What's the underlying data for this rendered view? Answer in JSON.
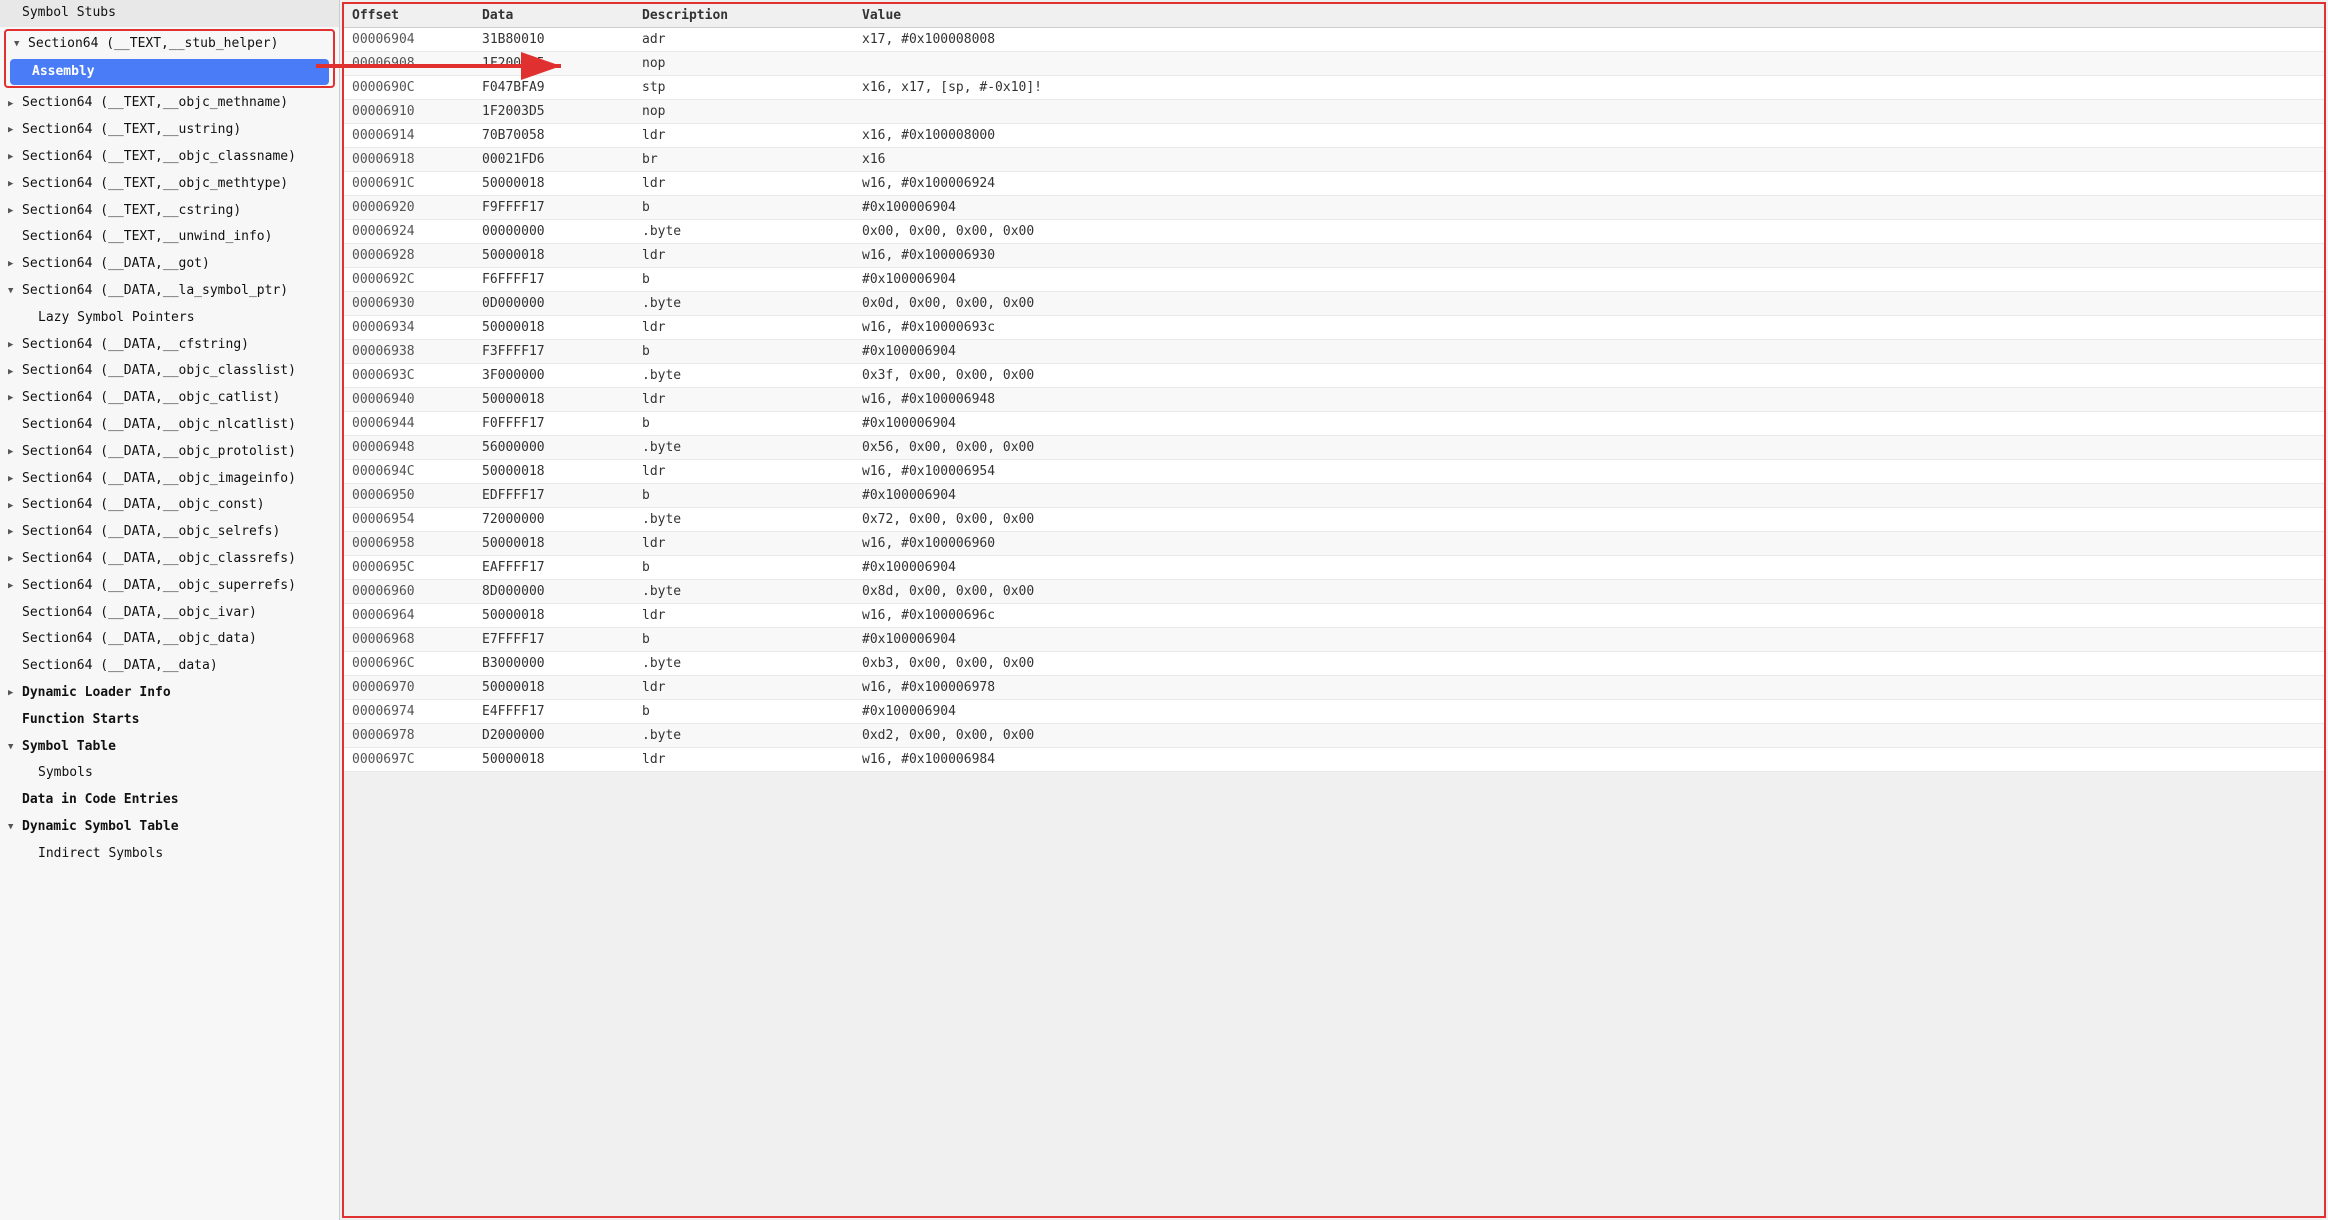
{
  "sidebar": {
    "items": [
      {
        "id": "symbol-stubs",
        "label": "Symbol Stubs",
        "indent": 0,
        "triangle": "none",
        "type": "leaf",
        "bold": false
      },
      {
        "id": "section64-stub-helper",
        "label": "Section64 (__TEXT,__stub_helper)",
        "indent": 0,
        "triangle": "open",
        "type": "parent",
        "bold": false,
        "highlighted": true
      },
      {
        "id": "assembly",
        "label": "Assembly",
        "indent": 1,
        "triangle": "none",
        "type": "selected",
        "bold": true
      },
      {
        "id": "section64-methname",
        "label": "Section64 (__TEXT,__objc_methname)",
        "indent": 0,
        "triangle": "closed",
        "type": "parent",
        "bold": false
      },
      {
        "id": "section64-ustring",
        "label": "Section64 (__TEXT,__ustring)",
        "indent": 0,
        "triangle": "closed",
        "type": "parent",
        "bold": false
      },
      {
        "id": "section64-classname",
        "label": "Section64 (__TEXT,__objc_classname)",
        "indent": 0,
        "triangle": "closed",
        "type": "parent",
        "bold": false
      },
      {
        "id": "section64-methtype",
        "label": "Section64 (__TEXT,__objc_methtype)",
        "indent": 0,
        "triangle": "closed",
        "type": "parent",
        "bold": false
      },
      {
        "id": "section64-cstring",
        "label": "Section64 (__TEXT,__cstring)",
        "indent": 0,
        "triangle": "closed",
        "type": "parent",
        "bold": false
      },
      {
        "id": "section64-unwind",
        "label": "Section64 (__TEXT,__unwind_info)",
        "indent": 0,
        "triangle": "none",
        "type": "leaf",
        "bold": false
      },
      {
        "id": "section64-got",
        "label": "Section64 (__DATA,__got)",
        "indent": 0,
        "triangle": "closed",
        "type": "parent",
        "bold": false
      },
      {
        "id": "section64-la-symbol",
        "label": "Section64 (__DATA,__la_symbol_ptr)",
        "indent": 0,
        "triangle": "open",
        "type": "parent",
        "bold": false
      },
      {
        "id": "lazy-symbol-pointers",
        "label": "Lazy Symbol Pointers",
        "indent": 1,
        "triangle": "none",
        "type": "leaf",
        "bold": false
      },
      {
        "id": "section64-cfstring",
        "label": "Section64 (__DATA,__cfstring)",
        "indent": 0,
        "triangle": "closed",
        "type": "parent",
        "bold": false
      },
      {
        "id": "section64-classlist",
        "label": "Section64 (__DATA,__objc_classlist)",
        "indent": 0,
        "triangle": "closed",
        "type": "parent",
        "bold": false
      },
      {
        "id": "section64-catlist",
        "label": "Section64 (__DATA,__objc_catlist)",
        "indent": 0,
        "triangle": "closed",
        "type": "parent",
        "bold": false
      },
      {
        "id": "section64-nlcatlist",
        "label": "Section64 (__DATA,__objc_nlcatlist)",
        "indent": 0,
        "triangle": "none",
        "type": "leaf",
        "bold": false
      },
      {
        "id": "section64-protolist",
        "label": "Section64 (__DATA,__objc_protolist)",
        "indent": 0,
        "triangle": "closed",
        "type": "parent",
        "bold": false
      },
      {
        "id": "section64-imageinfo",
        "label": "Section64 (__DATA,__objc_imageinfo)",
        "indent": 0,
        "triangle": "closed",
        "type": "parent",
        "bold": false
      },
      {
        "id": "section64-const",
        "label": "Section64 (__DATA,__objc_const)",
        "indent": 0,
        "triangle": "closed",
        "type": "parent",
        "bold": false
      },
      {
        "id": "section64-selrefs",
        "label": "Section64 (__DATA,__objc_selrefs)",
        "indent": 0,
        "triangle": "closed",
        "type": "parent",
        "bold": false
      },
      {
        "id": "section64-classrefs",
        "label": "Section64 (__DATA,__objc_classrefs)",
        "indent": 0,
        "triangle": "closed",
        "type": "parent",
        "bold": false
      },
      {
        "id": "section64-superrefs",
        "label": "Section64 (__DATA,__objc_superrefs)",
        "indent": 0,
        "triangle": "closed",
        "type": "parent",
        "bold": false
      },
      {
        "id": "section64-ivar",
        "label": "Section64 (__DATA,__objc_ivar)",
        "indent": 0,
        "triangle": "none",
        "type": "leaf",
        "bold": false
      },
      {
        "id": "section64-data",
        "label": "Section64 (__DATA,__objc_data)",
        "indent": 0,
        "triangle": "none",
        "type": "leaf",
        "bold": false
      },
      {
        "id": "section64-data2",
        "label": "Section64 (__DATA,__data)",
        "indent": 0,
        "triangle": "none",
        "type": "leaf",
        "bold": false
      },
      {
        "id": "dynamic-loader",
        "label": "Dynamic Loader Info",
        "indent": 0,
        "triangle": "closed",
        "type": "parent",
        "bold": true
      },
      {
        "id": "function-starts",
        "label": "Function Starts",
        "indent": 0,
        "triangle": "none",
        "type": "leaf",
        "bold": true
      },
      {
        "id": "symbol-table",
        "label": "Symbol Table",
        "indent": 0,
        "triangle": "open",
        "type": "parent",
        "bold": true
      },
      {
        "id": "symbols",
        "label": "Symbols",
        "indent": 1,
        "triangle": "none",
        "type": "leaf",
        "bold": false
      },
      {
        "id": "data-in-code",
        "label": "Data in Code Entries",
        "indent": 0,
        "triangle": "none",
        "type": "leaf",
        "bold": true
      },
      {
        "id": "dynamic-symbol-table",
        "label": "Dynamic Symbol Table",
        "indent": 0,
        "triangle": "open",
        "type": "parent",
        "bold": true
      },
      {
        "id": "indirect-symbols",
        "label": "Indirect Symbols",
        "indent": 1,
        "triangle": "none",
        "type": "leaf",
        "bold": false
      }
    ]
  },
  "table": {
    "headers": [
      "Offset",
      "Data",
      "Description",
      "Value"
    ],
    "rows": [
      {
        "offset": "00006904",
        "data": "31B80010",
        "desc": "adr",
        "value": "x17, #0x100008008"
      },
      {
        "offset": "00006908",
        "data": "1F2003D5",
        "desc": "nop",
        "value": ""
      },
      {
        "offset": "0000690C",
        "data": "F047BFA9",
        "desc": "stp",
        "value": "x16, x17, [sp, #-0x10]!"
      },
      {
        "offset": "00006910",
        "data": "1F2003D5",
        "desc": "nop",
        "value": ""
      },
      {
        "offset": "00006914",
        "data": "70B70058",
        "desc": "ldr",
        "value": "x16, #0x100008000"
      },
      {
        "offset": "00006918",
        "data": "00021FD6",
        "desc": "br",
        "value": "x16"
      },
      {
        "offset": "0000691C",
        "data": "50000018",
        "desc": "ldr",
        "value": "w16, #0x100006924"
      },
      {
        "offset": "00006920",
        "data": "F9FFFF17",
        "desc": "b",
        "value": "#0x100006904"
      },
      {
        "offset": "00006924",
        "data": "00000000",
        "desc": ".byte",
        "value": "0x00, 0x00, 0x00, 0x00"
      },
      {
        "offset": "00006928",
        "data": "50000018",
        "desc": "ldr",
        "value": "w16, #0x100006930"
      },
      {
        "offset": "0000692C",
        "data": "F6FFFF17",
        "desc": "b",
        "value": "#0x100006904"
      },
      {
        "offset": "00006930",
        "data": "0D000000",
        "desc": ".byte",
        "value": "0x0d, 0x00, 0x00, 0x00"
      },
      {
        "offset": "00006934",
        "data": "50000018",
        "desc": "ldr",
        "value": "w16, #0x10000693c"
      },
      {
        "offset": "00006938",
        "data": "F3FFFF17",
        "desc": "b",
        "value": "#0x100006904"
      },
      {
        "offset": "0000693C",
        "data": "3F000000",
        "desc": ".byte",
        "value": "0x3f, 0x00, 0x00, 0x00"
      },
      {
        "offset": "00006940",
        "data": "50000018",
        "desc": "ldr",
        "value": "w16, #0x100006948"
      },
      {
        "offset": "00006944",
        "data": "F0FFFF17",
        "desc": "b",
        "value": "#0x100006904"
      },
      {
        "offset": "00006948",
        "data": "56000000",
        "desc": ".byte",
        "value": "0x56, 0x00, 0x00, 0x00"
      },
      {
        "offset": "0000694C",
        "data": "50000018",
        "desc": "ldr",
        "value": "w16, #0x100006954"
      },
      {
        "offset": "00006950",
        "data": "EDFFFF17",
        "desc": "b",
        "value": "#0x100006904"
      },
      {
        "offset": "00006954",
        "data": "72000000",
        "desc": ".byte",
        "value": "0x72, 0x00, 0x00, 0x00"
      },
      {
        "offset": "00006958",
        "data": "50000018",
        "desc": "ldr",
        "value": "w16, #0x100006960"
      },
      {
        "offset": "0000695C",
        "data": "EAFFFF17",
        "desc": "b",
        "value": "#0x100006904"
      },
      {
        "offset": "00006960",
        "data": "8D000000",
        "desc": ".byte",
        "value": "0x8d, 0x00, 0x00, 0x00"
      },
      {
        "offset": "00006964",
        "data": "50000018",
        "desc": "ldr",
        "value": "w16, #0x10000696c"
      },
      {
        "offset": "00006968",
        "data": "E7FFFF17",
        "desc": "b",
        "value": "#0x100006904"
      },
      {
        "offset": "0000696C",
        "data": "B3000000",
        "desc": ".byte",
        "value": "0xb3, 0x00, 0x00, 0x00"
      },
      {
        "offset": "00006970",
        "data": "50000018",
        "desc": "ldr",
        "value": "w16, #0x100006978"
      },
      {
        "offset": "00006974",
        "data": "E4FFFF17",
        "desc": "b",
        "value": "#0x100006904"
      },
      {
        "offset": "00006978",
        "data": "D2000000",
        "desc": ".byte",
        "value": "0xd2, 0x00, 0x00, 0x00"
      },
      {
        "offset": "0000697C",
        "data": "50000018",
        "desc": "ldr",
        "value": "w16, #0x100006984"
      }
    ]
  }
}
